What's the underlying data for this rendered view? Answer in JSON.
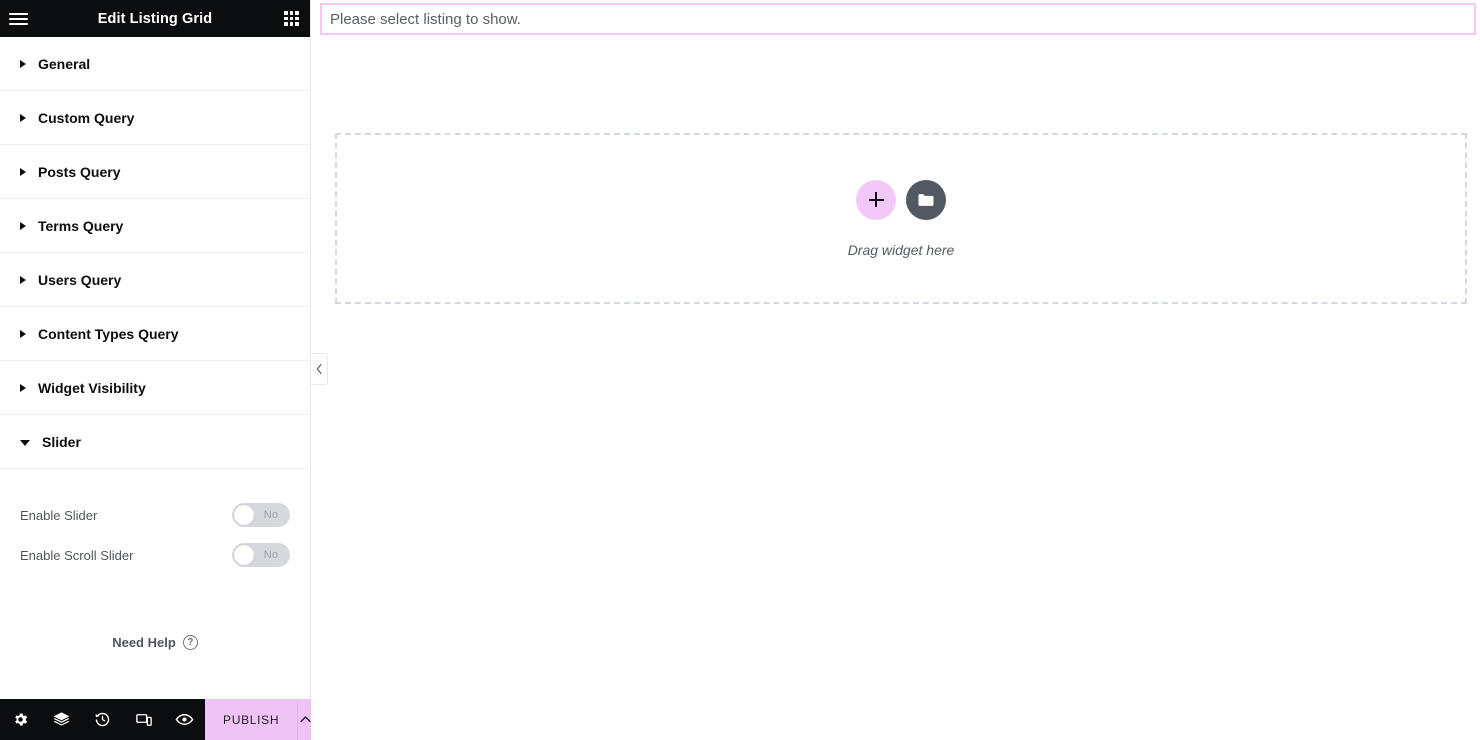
{
  "panel": {
    "header": {
      "menu_icon": "hamburger-menu-icon",
      "title": "Edit Listing Grid",
      "apps_icon": "widgets-grid-icon"
    },
    "sections": [
      {
        "label": "General",
        "expanded": false
      },
      {
        "label": "Custom Query",
        "expanded": false
      },
      {
        "label": "Posts Query",
        "expanded": false
      },
      {
        "label": "Terms Query",
        "expanded": false
      },
      {
        "label": "Users Query",
        "expanded": false
      },
      {
        "label": "Content Types Query",
        "expanded": false
      },
      {
        "label": "Widget Visibility",
        "expanded": false
      },
      {
        "label": "Slider",
        "expanded": true
      }
    ],
    "controls": [
      {
        "label": "Enable Slider",
        "value": "No",
        "state": "off"
      },
      {
        "label": "Enable Scroll Slider",
        "value": "No",
        "state": "off"
      }
    ],
    "need_help": {
      "label": "Need Help",
      "icon": "question-mark-circle-icon"
    },
    "collapse_handle": {
      "icon": "chevron-left-icon"
    },
    "footer": {
      "tools": [
        {
          "name": "settings-icon",
          "title": "Settings"
        },
        {
          "name": "navigator-icon",
          "title": "Navigator"
        },
        {
          "name": "history-icon",
          "title": "History"
        },
        {
          "name": "responsive-mode-icon",
          "title": "Responsive Mode"
        },
        {
          "name": "preview-eye-icon",
          "title": "Preview Changes"
        }
      ],
      "publish_label": "PUBLISH",
      "publish_caret_icon": "chevron-up-icon"
    }
  },
  "canvas": {
    "notice": "Please select listing to show.",
    "dropzone": {
      "add_widget_icon": "plus-icon",
      "template_icon": "folder-icon",
      "caption": "Drag widget here"
    }
  },
  "colors": {
    "panel_header_bg": "#0c0d0e",
    "accent_pink": "#f0c3f7",
    "notice_border": "#f2c8f0",
    "toggle_track": "#d5d8dc",
    "dropzone_border": "#d4d9dd",
    "template_btn_bg": "#515962"
  }
}
